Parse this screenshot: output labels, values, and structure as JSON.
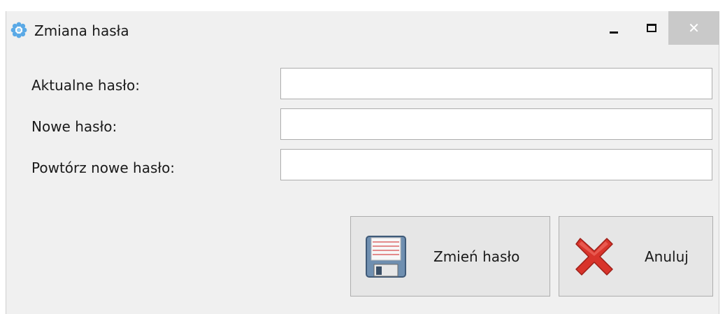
{
  "window": {
    "title": "Zmiana hasła",
    "icon": "gear-flower-icon",
    "controls": {
      "minimize": "minimize-icon",
      "maximize": "maximize-icon",
      "close": "close-icon",
      "close_glyph": "✕"
    }
  },
  "form": {
    "current_password": {
      "label": "Aktualne hasło:",
      "value": ""
    },
    "new_password": {
      "label": "Nowe hasło:",
      "value": ""
    },
    "repeat_password": {
      "label": "Powtórz nowe hasło:",
      "value": ""
    }
  },
  "buttons": {
    "save": {
      "label": "Zmień hasło",
      "icon": "floppy-disk-icon"
    },
    "cancel": {
      "label": "Anuluj",
      "icon": "red-x-icon"
    }
  },
  "colors": {
    "window_bg": "#f0f0f0",
    "button_bg": "#e6e6e6",
    "close_hover": "#c9c9c9",
    "cancel_red": "#d8342b"
  }
}
